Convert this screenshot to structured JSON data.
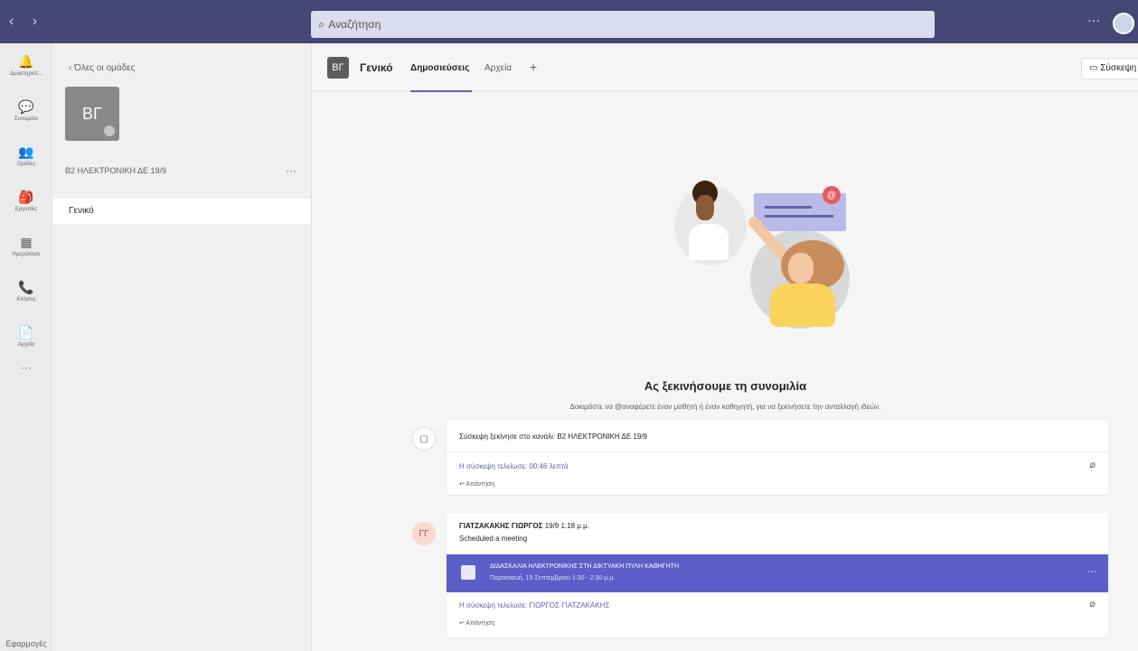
{
  "titlebar": {
    "nav": "‹ ›",
    "search_placeholder": "Αναζήτηση",
    "more": "···"
  },
  "rail": {
    "items": [
      {
        "icon": "🔔",
        "label": "Δραστηριότ..."
      },
      {
        "icon": "💬",
        "label": "Συνομιλία"
      },
      {
        "icon": "👥",
        "label": "Ομάδες"
      },
      {
        "icon": "🎒",
        "label": "Εργασίες"
      },
      {
        "icon": "▦",
        "label": "Ημερολόγιο"
      },
      {
        "icon": "📞",
        "label": "Κλήσεις"
      },
      {
        "icon": "📄",
        "label": "Αρχεία"
      }
    ],
    "more": "···",
    "bottom": "Εφαρμογές"
  },
  "team_panel": {
    "back": "‹ Όλες οι ομάδες",
    "avatar_initials": "ΒΓ",
    "team_name": "Β2 ΗΛΕΚΤΡΟΝΙΚΗ ΔΕ 19/9",
    "more": "···",
    "channel": "Γενικό"
  },
  "header": {
    "channel_icon": "ΒΓ",
    "channel_title": "Γενικό",
    "tabs": [
      "Δημοσιεύσεις",
      "Αρχεία"
    ],
    "add_tab": "+",
    "meet_button": "Σύσκεψη"
  },
  "empty_state": {
    "badge": "@",
    "heading": "Ας ξεκινήσουμε τη συνομιλία",
    "subheading": "Δοκιμάστε να @αναφέρετε έναν μαθητή ή έναν καθηγητή, για να ξεκινήσετε την ανταλλαγή ιδεών."
  },
  "posts": [
    {
      "icon": "▢",
      "line1": "Σύσκεψη ξεκίνησε στο κανάλι: Β2 ΗΛΕΚΤΡΟΝΙΚΗ ΔΕ 19/9",
      "link": "Η σύσκεψη τελείωσε: 00:46 λεπτά",
      "reply": "↩ Απάντηση"
    },
    {
      "avatar": "ΓΓ",
      "author": "ΓΙΑΤΖΑΚΑΚΗΣ ΓΙΩΡΓΟΣ",
      "time": "19/9 1:18 μ.μ.",
      "line": "Scheduled a meeting",
      "meeting_title": "ΔΙΔΑΣΚΑΛΙΑ ΗΛΕΚΤΡΟΝΙΚΗΣ ΣΤΗ ΔΙΚΤΥΑΚΗ ΠΥΛΗ ΚΑΘΗΓΗΤΗ",
      "meeting_time": "Παρασκευή, 19 Σεπτεμβρίου 1:30 - 2:30 μ.μ.",
      "meeting_more": "···",
      "link": "Η σύσκεψη τελείωσε: ΓΙΩΡΓΟΣ ΓΙΑΤΖΑΚΑΚΗΣ",
      "reply": "↩ Απάντηση"
    }
  ],
  "colors": {
    "titlebar": "#464775",
    "accent": "#6264a7",
    "meeting_bar": "#5b5fc7"
  }
}
